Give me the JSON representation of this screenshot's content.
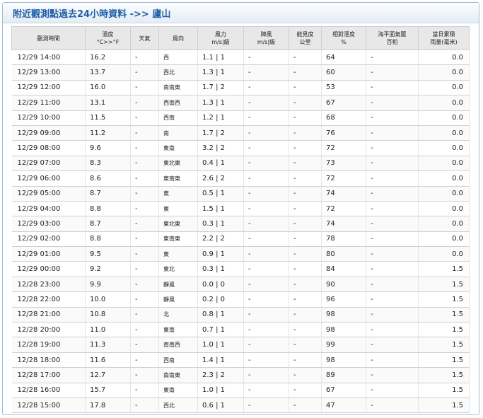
{
  "title": "附近觀測點過去24小時資料 ->> 廬山",
  "headers": [
    [
      "觀測時間"
    ],
    [
      "溫度",
      "°C>>°F"
    ],
    [
      "天氣"
    ],
    [
      "風向"
    ],
    [
      "風力",
      "m/s|級"
    ],
    [
      "陣風",
      "m/s|級"
    ],
    [
      "能見度",
      "公里"
    ],
    [
      "相對溼度",
      "%"
    ],
    [
      "海平面氣壓",
      "百帕"
    ],
    [
      "當日累積",
      "雨量(毫米)"
    ]
  ],
  "rows": [
    [
      "12/29 14:00",
      "16.2",
      "-",
      "西",
      "1.1 | 1",
      "-",
      "-",
      "64",
      "-",
      "0.0"
    ],
    [
      "12/29 13:00",
      "13.7",
      "-",
      "西北",
      "1.3 | 1",
      "-",
      "-",
      "60",
      "-",
      "0.0"
    ],
    [
      "12/29 12:00",
      "16.0",
      "-",
      "南南東",
      "1.7 | 2",
      "-",
      "-",
      "53",
      "-",
      "0.0"
    ],
    [
      "12/29 11:00",
      "13.1",
      "-",
      "西南西",
      "1.3 | 1",
      "-",
      "-",
      "67",
      "-",
      "0.0"
    ],
    [
      "12/29 10:00",
      "11.5",
      "-",
      "西南",
      "1.2 | 1",
      "-",
      "-",
      "68",
      "-",
      "0.0"
    ],
    [
      "12/29 09:00",
      "11.2",
      "-",
      "南",
      "1.7 | 2",
      "-",
      "-",
      "76",
      "-",
      "0.0"
    ],
    [
      "12/29 08:00",
      "9.6",
      "-",
      "東南",
      "3.2 | 2",
      "-",
      "-",
      "72",
      "-",
      "0.0"
    ],
    [
      "12/29 07:00",
      "8.3",
      "-",
      "東北東",
      "0.4 | 1",
      "-",
      "-",
      "73",
      "-",
      "0.0"
    ],
    [
      "12/29 06:00",
      "8.6",
      "-",
      "東南東",
      "2.6 | 2",
      "-",
      "-",
      "72",
      "-",
      "0.0"
    ],
    [
      "12/29 05:00",
      "8.7",
      "-",
      "東",
      "0.5 | 1",
      "-",
      "-",
      "74",
      "-",
      "0.0"
    ],
    [
      "12/29 04:00",
      "8.8",
      "-",
      "東",
      "1.5 | 1",
      "-",
      "-",
      "72",
      "-",
      "0.0"
    ],
    [
      "12/29 03:00",
      "8.7",
      "-",
      "東北東",
      "0.3 | 1",
      "-",
      "-",
      "74",
      "-",
      "0.0"
    ],
    [
      "12/29 02:00",
      "8.8",
      "-",
      "東南東",
      "2.2 | 2",
      "-",
      "-",
      "78",
      "-",
      "0.0"
    ],
    [
      "12/29 01:00",
      "9.5",
      "-",
      "東",
      "0.9 | 1",
      "-",
      "-",
      "80",
      "-",
      "0.0"
    ],
    [
      "12/29 00:00",
      "9.2",
      "-",
      "東北",
      "0.3 | 1",
      "-",
      "-",
      "84",
      "-",
      "1.5"
    ],
    [
      "12/28 23:00",
      "9.9",
      "-",
      "靜風",
      "0.0 | 0",
      "-",
      "-",
      "90",
      "-",
      "1.5"
    ],
    [
      "12/28 22:00",
      "10.0",
      "-",
      "靜風",
      "0.2 | 0",
      "-",
      "-",
      "96",
      "-",
      "1.5"
    ],
    [
      "12/28 21:00",
      "10.8",
      "-",
      "北",
      "0.8 | 1",
      "-",
      "-",
      "98",
      "-",
      "1.5"
    ],
    [
      "12/28 20:00",
      "11.0",
      "-",
      "東南",
      "0.7 | 1",
      "-",
      "-",
      "98",
      "-",
      "1.5"
    ],
    [
      "12/28 19:00",
      "11.3",
      "-",
      "南南西",
      "1.0 | 1",
      "-",
      "-",
      "99",
      "-",
      "1.5"
    ],
    [
      "12/28 18:00",
      "11.6",
      "-",
      "西南",
      "1.4 | 1",
      "-",
      "-",
      "98",
      "-",
      "1.5"
    ],
    [
      "12/28 17:00",
      "12.7",
      "-",
      "南南東",
      "2.3 | 2",
      "-",
      "-",
      "89",
      "-",
      "1.5"
    ],
    [
      "12/28 16:00",
      "15.7",
      "-",
      "東南",
      "1.0 | 1",
      "-",
      "-",
      "67",
      "-",
      "1.5"
    ],
    [
      "12/28 15:00",
      "17.8",
      "-",
      "西北",
      "0.6 | 1",
      "-",
      "-",
      "47",
      "-",
      "1.5"
    ]
  ],
  "colors": {
    "title_text": "#1f5fa6",
    "panel_border": "#9fbcd9",
    "header_bg": "#e8e8e8"
  }
}
